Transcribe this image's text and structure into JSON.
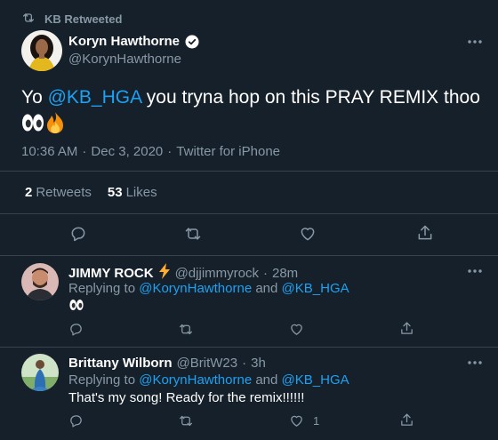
{
  "retweet_header": {
    "label": "KB Retweeted",
    "icon": "retweet-icon"
  },
  "main_tweet": {
    "author_name": "Koryn Hawthorne",
    "author_handle": "@KorynHawthorne",
    "verified": true,
    "text_prefix": "Yo ",
    "mention": "@KB_HGA",
    "text_suffix": " you tryna hop on this PRAY REMIX thoo",
    "emojis": [
      "eyes-emoji",
      "fire-emoji"
    ],
    "time": "10:36 AM",
    "separator": "·",
    "date": "Dec 3, 2020",
    "source": "Twitter for iPhone",
    "retweets_count": "2",
    "retweets_label": "Retweets",
    "likes_count": "53",
    "likes_label": "Likes"
  },
  "replies": [
    {
      "name": "JIMMY ROCK",
      "name_emoji": "lightning-emoji",
      "handle": "@djjimmyrock",
      "separator": "·",
      "time": "28m",
      "replying_prefix": "Replying to",
      "mention1": "@KorynHawthorne",
      "and_word": "and",
      "mention2": "@KB_HGA",
      "text": "",
      "text_emoji": "eyes-emoji",
      "reply_count": "",
      "retweet_count": "",
      "like_count": ""
    },
    {
      "name": "Brittany Wilborn",
      "handle": "@BritW23",
      "separator": "·",
      "time": "3h",
      "replying_prefix": "Replying to",
      "mention1": "@KorynHawthorne",
      "and_word": "and",
      "mention2": "@KB_HGA",
      "text": "That's my song! Ready for the remix!!!!!!",
      "reply_count": "",
      "retweet_count": "",
      "like_count": "1"
    }
  ],
  "colors": {
    "background": "#15202b",
    "text": "#ffffff",
    "muted": "#8899a6",
    "link": "#1da1f2",
    "divider": "#38444d"
  }
}
